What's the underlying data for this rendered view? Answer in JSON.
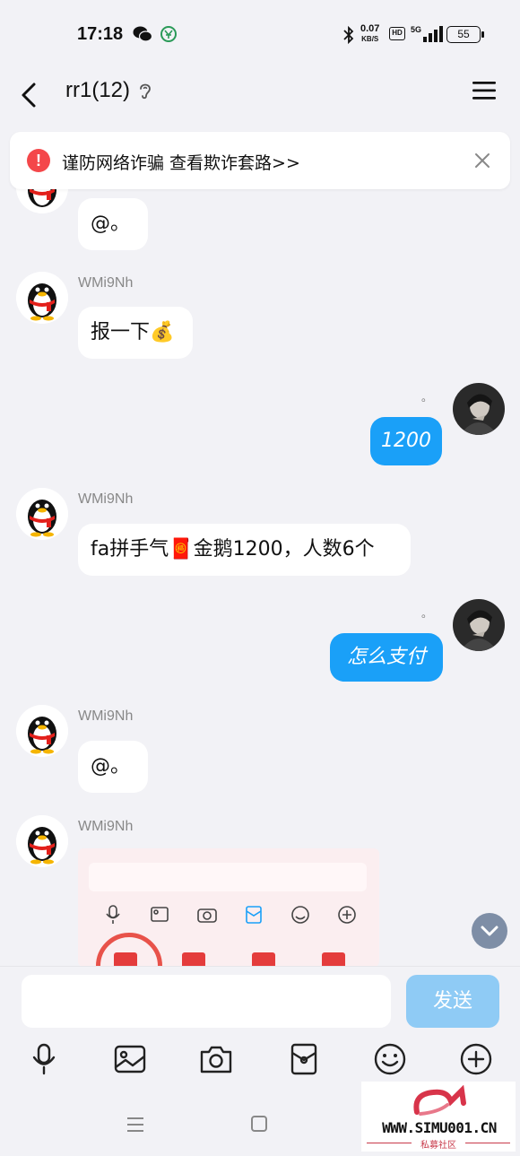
{
  "status_bar": {
    "time": "17:18",
    "speed_value": "0.07",
    "speed_unit": "KB/S",
    "hd": "HD",
    "network": "5G",
    "battery": "55"
  },
  "header": {
    "title": "rr1(12)"
  },
  "banner": {
    "text": "谨防网络诈骗 查看欺诈套路>>"
  },
  "messages": [
    {
      "sender": "",
      "text": "@。"
    },
    {
      "sender": "WMi9Nh",
      "text": "报一下💰"
    },
    {
      "self": true,
      "text": "1200"
    },
    {
      "sender": "WMi9Nh",
      "text": "fa拼手气🧧金鹅1200，人数6个"
    },
    {
      "self": true,
      "text": "怎么支付"
    },
    {
      "sender": "WMi9Nh",
      "text": "@。"
    },
    {
      "sender": "WMi9Nh",
      "type": "image"
    }
  ],
  "dot": "。",
  "input": {
    "placeholder": "",
    "send_label": "发送"
  },
  "watermark": {
    "site": "WWW.SIMU001.CN",
    "sub": "私募社区"
  },
  "icons": {
    "tools": [
      "microphone-icon",
      "image-icon",
      "camera-icon",
      "red-packet-icon",
      "emoji-icon",
      "plus-icon"
    ]
  }
}
